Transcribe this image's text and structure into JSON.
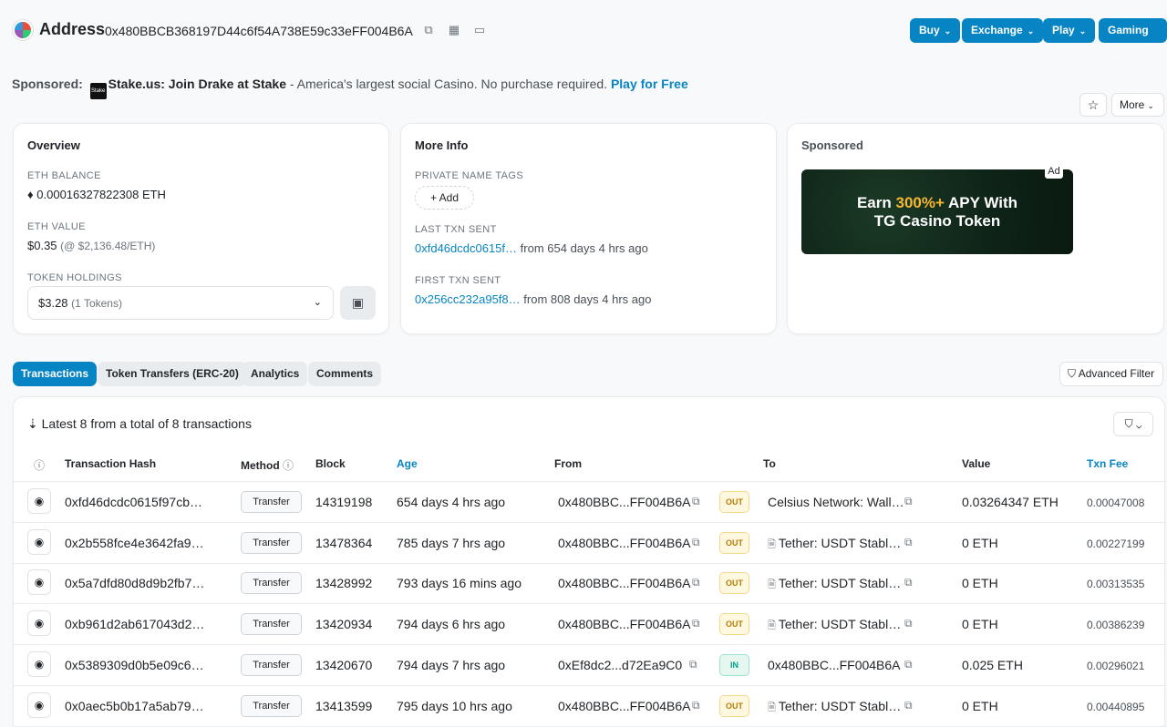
{
  "header": {
    "title": "Address",
    "address": "0x480BBCB368197D44c6f54A738E59c33eFF004B6A",
    "nav": [
      "Buy",
      "Exchange",
      "Play",
      "Gaming"
    ]
  },
  "sponsored_line": {
    "label": "Sponsored:",
    "logo_text": "Stake",
    "brand": "Stake.us: Join Drake at Stake",
    "text": " - America's largest social Casino. No purchase required. ",
    "cta": "Play for Free"
  },
  "actions": {
    "more": "More"
  },
  "overview": {
    "title": "Overview",
    "eth_balance_label": "ETH BALANCE",
    "eth_balance": "0.00016327822308 ETH",
    "eth_value_label": "ETH VALUE",
    "eth_value": "$0.35",
    "eth_price": "(@ $2,136.48/ETH)",
    "token_label": "TOKEN HOLDINGS",
    "token_value": "$3.28",
    "token_count": "(1 Tokens)"
  },
  "more_info": {
    "title": "More Info",
    "tags_label": "PRIVATE NAME TAGS",
    "add_label": "Add",
    "last_label": "LAST TXN SENT",
    "last_hash": "0xfd46dcdc0615f…",
    "last_from": "from 654 days 4 hrs ago",
    "first_label": "FIRST TXN SENT",
    "first_hash": "0x256cc232a95f8…",
    "first_from": "from 808 days 4 hrs ago"
  },
  "sponsored_card": {
    "title": "Sponsored",
    "ad_tag": "Ad",
    "line1_a": "Earn ",
    "line1_hl": "300%+",
    "line1_b": " APY With",
    "line2": "TG Casino Token"
  },
  "tabs": [
    "Transactions",
    "Token Transfers (ERC-20)",
    "Analytics",
    "Comments"
  ],
  "advanced_filter": "Advanced Filter",
  "table": {
    "summary": "Latest 8 from a total of 8 transactions",
    "headers": {
      "hash": "Transaction Hash",
      "method": "Method",
      "block": "Block",
      "age": "Age",
      "from": "From",
      "to": "To",
      "value": "Value",
      "fee": "Txn Fee"
    },
    "rows": [
      {
        "hash": "0xfd46dcdc0615f97cb…",
        "method": "Transfer",
        "block": "14319198",
        "age": "654 days 4 hrs ago",
        "from": "0x480BBC...FF004B6A",
        "dir": "OUT",
        "to": "Celsius Network: Wall…",
        "value": "0.03264347 ETH",
        "fee": "0.00047008"
      },
      {
        "hash": "0x2b558fce4e3642fa9…",
        "method": "Transfer",
        "block": "13478364",
        "age": "785 days 7 hrs ago",
        "from": "0x480BBC...FF004B6A",
        "dir": "OUT",
        "to": "Tether: USDT Stabl…",
        "value": "0 ETH",
        "fee": "0.00227199"
      },
      {
        "hash": "0x5a7dfd80d8d9b2fb7…",
        "method": "Transfer",
        "block": "13428992",
        "age": "793 days 16 mins ago",
        "from": "0x480BBC...FF004B6A",
        "dir": "OUT",
        "to": "Tether: USDT Stabl…",
        "value": "0 ETH",
        "fee": "0.00313535"
      },
      {
        "hash": "0xb961d2ab617043d2…",
        "method": "Transfer",
        "block": "13420934",
        "age": "794 days 6 hrs ago",
        "from": "0x480BBC...FF004B6A",
        "dir": "OUT",
        "to": "Tether: USDT Stabl…",
        "value": "0 ETH",
        "fee": "0.00386239"
      },
      {
        "hash": "0x5389309d0b5e09c6…",
        "method": "Transfer",
        "block": "13420670",
        "age": "794 days 7 hrs ago",
        "from": "0xEf8dc2...d72Ea9C0",
        "dir": "IN",
        "to": "0x480BBC...FF004B6A",
        "value": "0.025 ETH",
        "fee": "0.00296021"
      },
      {
        "hash": "0x0aec5b0b17a5ab79…",
        "method": "Transfer",
        "block": "13413599",
        "age": "795 days 10 hrs ago",
        "from": "0x480BBC...FF004B6A",
        "dir": "OUT",
        "to": "Tether: USDT Stabl…",
        "value": "0 ETH",
        "fee": "0.00440895"
      }
    ]
  }
}
